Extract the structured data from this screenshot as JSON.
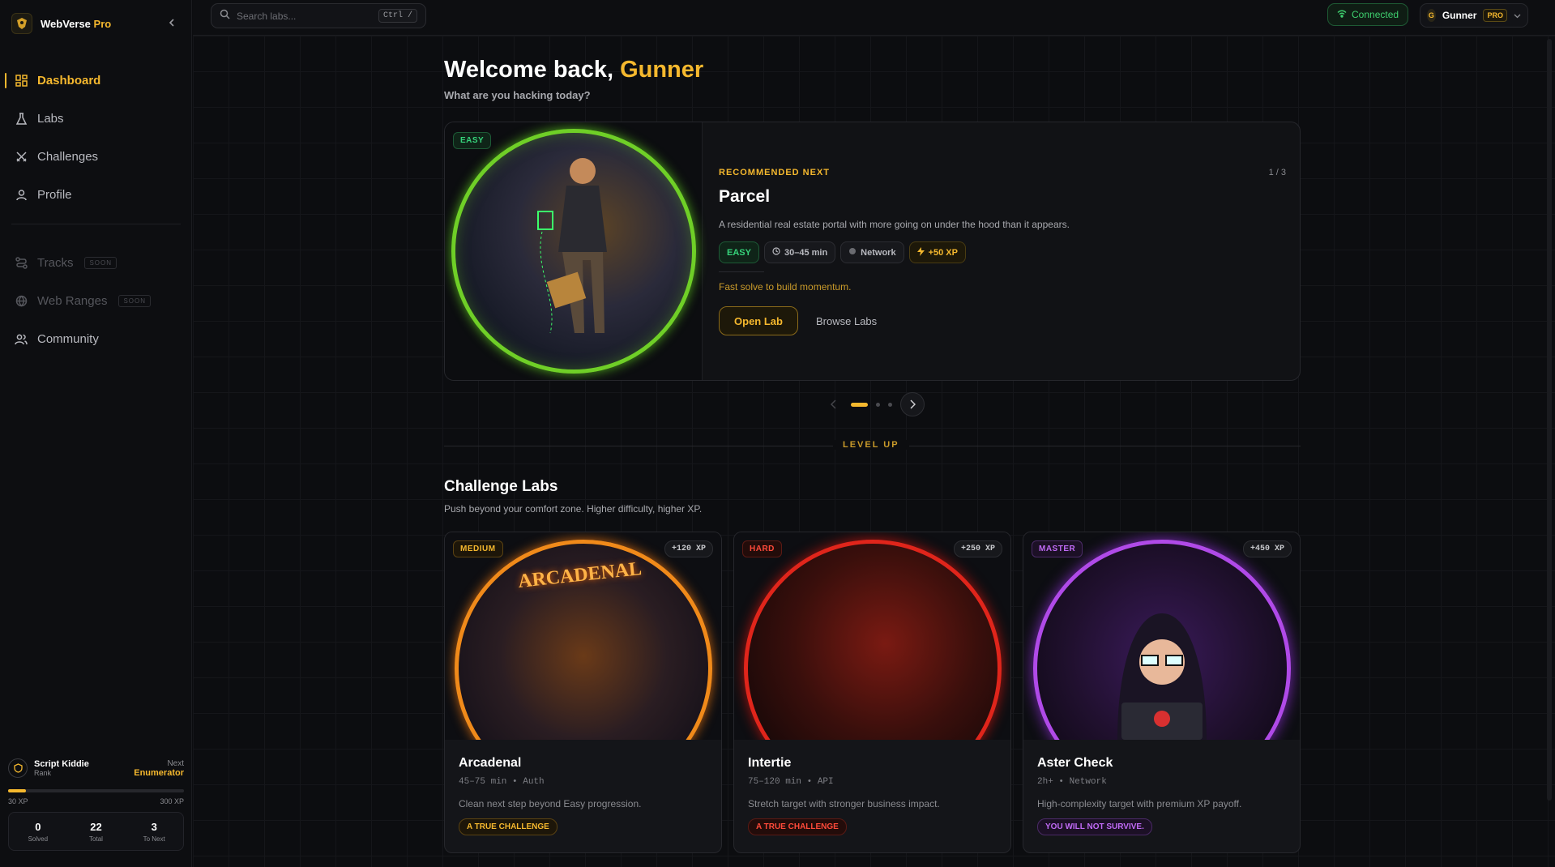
{
  "brand": {
    "name": "WebVerse",
    "suffix": "Pro"
  },
  "nav": {
    "items": [
      {
        "label": "Dashboard",
        "icon": "grid-icon",
        "active": true
      },
      {
        "label": "Labs",
        "icon": "flask-icon"
      },
      {
        "label": "Challenges",
        "icon": "swords-icon"
      },
      {
        "label": "Profile",
        "icon": "user-icon"
      }
    ],
    "soon_items": [
      {
        "label": "Tracks",
        "badge": "SOON",
        "icon": "route-icon"
      },
      {
        "label": "Web Ranges",
        "badge": "SOON",
        "icon": "globe-icon"
      }
    ],
    "community": {
      "label": "Community",
      "icon": "users-icon"
    }
  },
  "rank": {
    "title": "Script Kiddie",
    "sub": "Rank",
    "next_label": "Next",
    "next_value": "Enumerator",
    "xp_current": "30 XP",
    "xp_next": "300 XP",
    "progress": 0.1,
    "stats": [
      {
        "value": "0",
        "label": "Solved"
      },
      {
        "value": "22",
        "label": "Total"
      },
      {
        "value": "3",
        "label": "To Next"
      }
    ]
  },
  "topbar": {
    "search_placeholder": "Search labs...",
    "shortcut": "Ctrl /",
    "status": "Connected",
    "user_initial": "G",
    "user_name": "Gunner",
    "plan": "PRO"
  },
  "welcome": {
    "prefix": "Welcome back, ",
    "name": "Gunner",
    "subtitle": "What are you hacking today?"
  },
  "hero": {
    "tag": "EASY",
    "eyebrow": "RECOMMENDED NEXT",
    "counter": "1 / 3",
    "title": "Parcel",
    "description": "A residential real estate portal with more going on under the hood than it appears.",
    "chips": {
      "difficulty": "EASY",
      "time": "30–45 min",
      "category": "Network",
      "xp": "+50 XP"
    },
    "note": "Fast solve to build momentum.",
    "primary": "Open Lab",
    "secondary": "Browse Labs"
  },
  "section": {
    "label": "LEVEL UP",
    "title": "Challenge Labs",
    "subtitle": "Push beyond your comfort zone. Higher difficulty, higher XP."
  },
  "cards": [
    {
      "tag": "MEDIUM",
      "xp": "+120 XP",
      "name": "Arcadenal",
      "meta": "45–75 min • Auth",
      "desc": "Clean next step beyond Easy progression.",
      "badge": "A TRUE CHALLENGE"
    },
    {
      "tag": "HARD",
      "xp": "+250 XP",
      "name": "Intertie",
      "meta": "75–120 min • API",
      "desc": "Stretch target with stronger business impact.",
      "badge": "A TRUE CHALLENGE"
    },
    {
      "tag": "MASTER",
      "xp": "+450 XP",
      "name": "Aster Check",
      "meta": "2h+ • Network",
      "desc": "High-complexity target with premium XP payoff.",
      "badge": "YOU WILL NOT SURVIVE."
    }
  ],
  "colors": {
    "accent": "#f5b82e",
    "easy": "#36d27a",
    "hard": "#ff4a3a",
    "master": "#c06af5",
    "connected": "#3ecf6e"
  }
}
